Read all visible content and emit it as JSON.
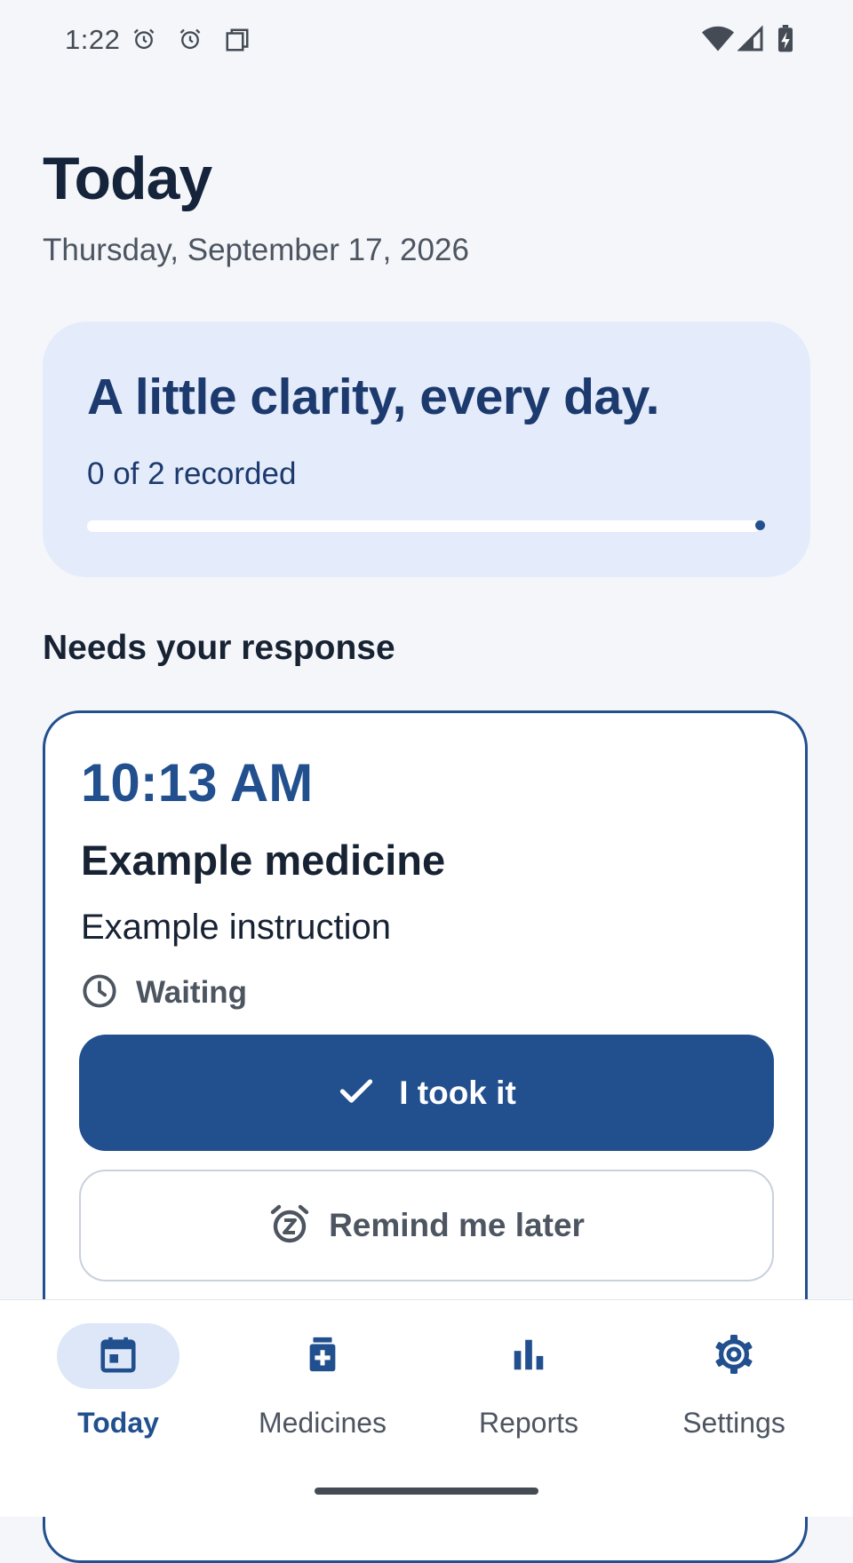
{
  "status_bar": {
    "time": "1:22",
    "left_icons": [
      "alarm-icon",
      "alarm-icon",
      "screenshot-icon"
    ],
    "right_icons": [
      "wifi-icon",
      "cell-signal-icon",
      "battery-charging-icon"
    ]
  },
  "header": {
    "title": "Today",
    "date": "Thursday, September 17, 2026"
  },
  "summary": {
    "headline": "A little clarity, every day.",
    "progress_text": "0 of 2 recorded",
    "recorded": 0,
    "total": 2,
    "progress_fraction": 0
  },
  "section_title": "Needs your response",
  "dose": {
    "time": "10:13 AM",
    "name": "Example medicine",
    "instruction": "Example instruction",
    "status": "Waiting",
    "status_icon": "clock-icon",
    "primary_button": {
      "label": "I took it",
      "icon": "check-icon"
    },
    "secondary_button": {
      "label": "Remind me later",
      "icon": "snooze-alarm-icon"
    }
  },
  "bottom_nav": {
    "items": [
      {
        "label": "Today",
        "icon": "calendar-icon",
        "active": true
      },
      {
        "label": "Medicines",
        "icon": "medicine-bottle-icon",
        "active": false
      },
      {
        "label": "Reports",
        "icon": "bar-chart-icon",
        "active": false
      },
      {
        "label": "Settings",
        "icon": "gear-icon",
        "active": false
      }
    ]
  },
  "colors": {
    "primary": "#22508f",
    "background": "#f4f6fa",
    "summary_card": "#e4ecfb",
    "text_dark": "#172233",
    "text_muted": "#4d5561"
  }
}
